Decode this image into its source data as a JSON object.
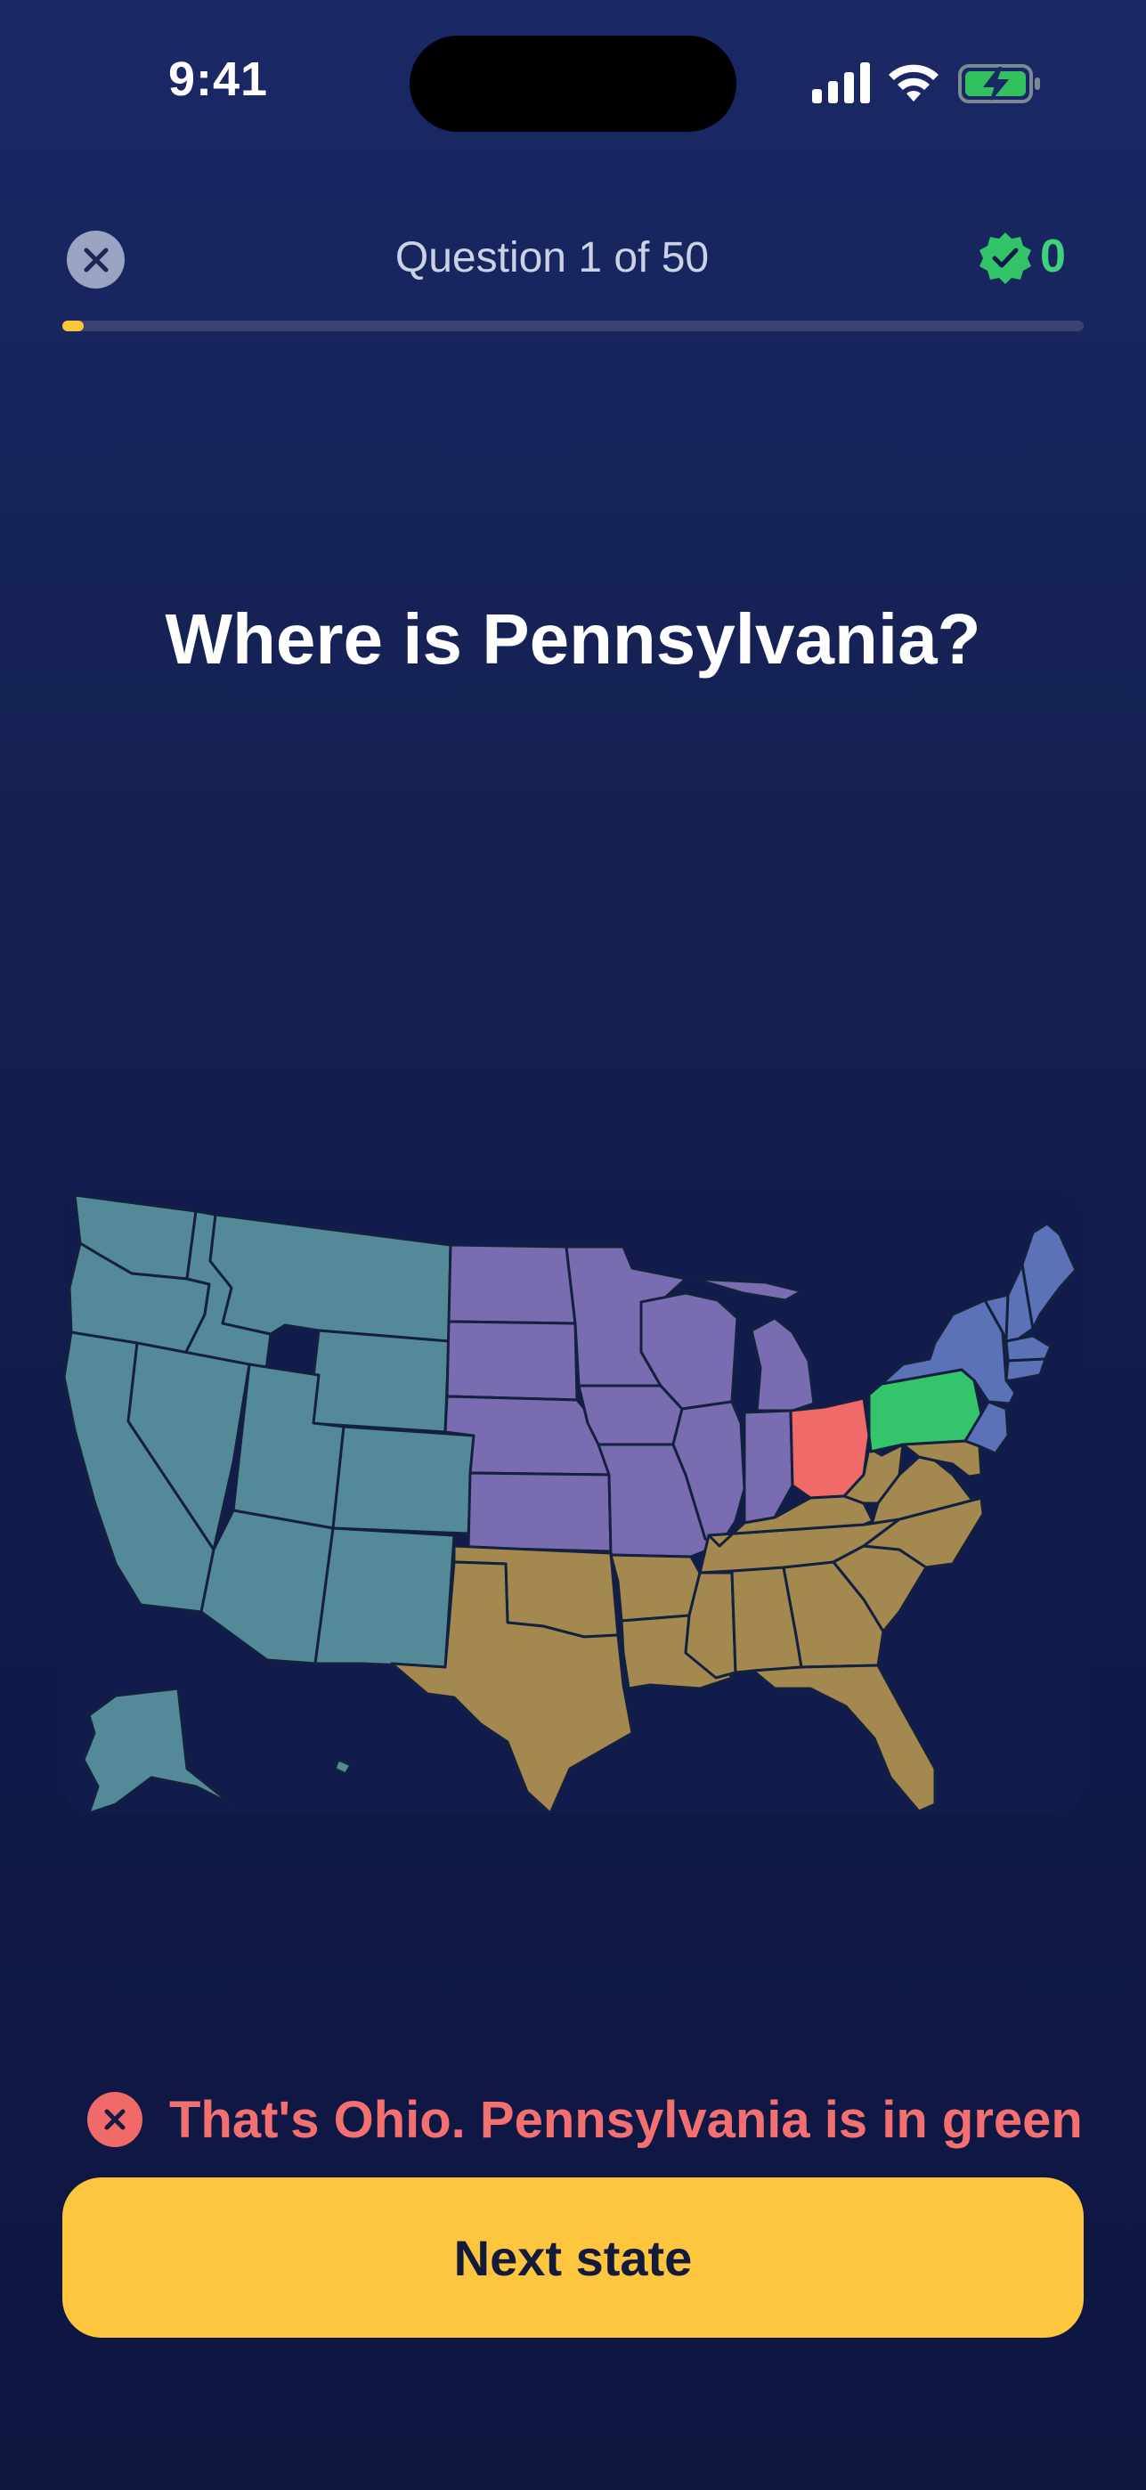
{
  "status_bar": {
    "time": "9:41",
    "icons": [
      "cellular-signal-icon",
      "wifi-icon",
      "battery-charging-icon"
    ]
  },
  "header": {
    "close_icon": "close-icon",
    "question_counter": "Question 1 of 50",
    "score_icon": "verified-badge-icon",
    "score": "0",
    "progress": 0.02
  },
  "question": {
    "prompt": "Where is Pennsylvania?"
  },
  "map": {
    "region_colors": {
      "west": "#548a98",
      "midwest": "#7a6cb0",
      "south": "#a3894f",
      "northeast": "#5b73b6",
      "wrong_guess": "#f06a6a",
      "correct_answer": "#34c46c"
    },
    "highlighted_wrong": "Ohio",
    "highlighted_correct": "Pennsylvania"
  },
  "feedback": {
    "icon": "error-x-icon",
    "message": "That's Ohio. Pennsylvania is in green",
    "color": "#f47070"
  },
  "actions": {
    "next_label": "Next state"
  },
  "colors": {
    "accent": "#fdc63e",
    "success": "#3ed27a",
    "background": "#142050"
  }
}
